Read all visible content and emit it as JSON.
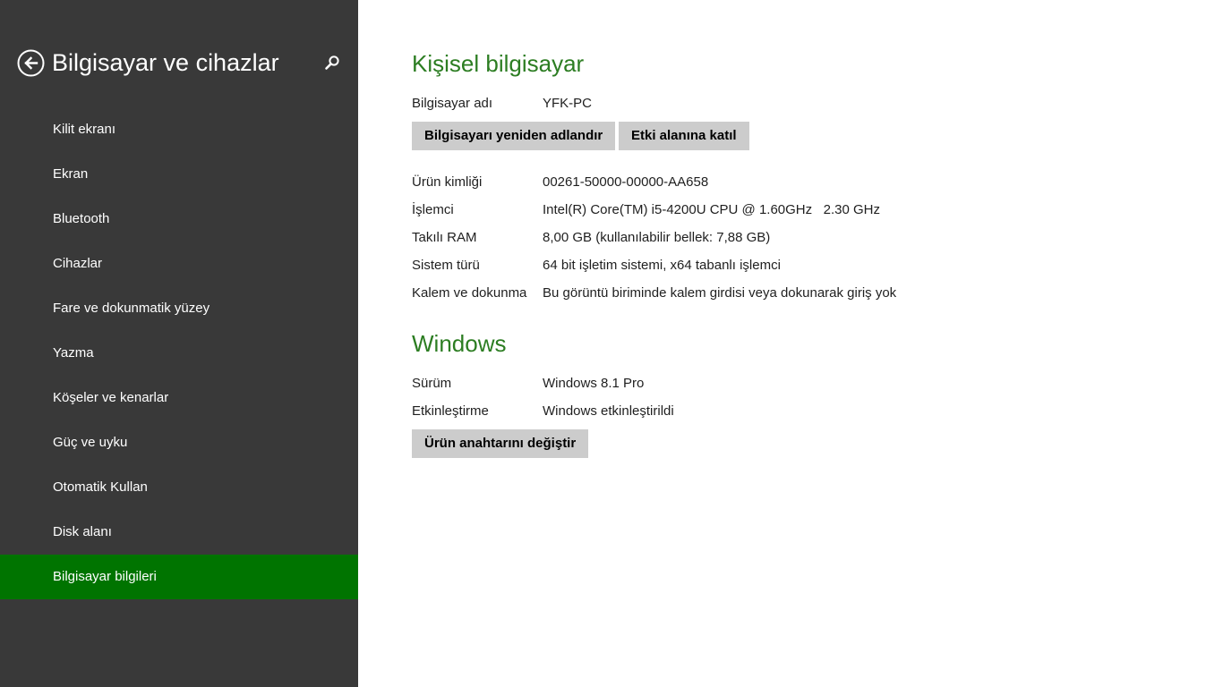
{
  "sidebar": {
    "title": "Bilgisayar ve cihazlar",
    "items": [
      {
        "label": "Kilit ekranı"
      },
      {
        "label": "Ekran"
      },
      {
        "label": "Bluetooth"
      },
      {
        "label": "Cihazlar"
      },
      {
        "label": "Fare ve dokunmatik yüzey"
      },
      {
        "label": "Yazma"
      },
      {
        "label": "Köşeler ve kenarlar"
      },
      {
        "label": "Güç ve uyku"
      },
      {
        "label": "Otomatik Kullan"
      },
      {
        "label": "Disk alanı"
      },
      {
        "label": "Bilgisayar bilgileri"
      }
    ],
    "active_index": 10,
    "background_color": "#393939",
    "active_color": "#007400"
  },
  "pc": {
    "title": "Kişisel bilgisayar",
    "name_label": "Bilgisayar adı",
    "name_value": "YFK-PC",
    "rename_button": "Bilgisayarı yeniden adlandır",
    "join_domain_button": "Etki alanına katıl",
    "specs": [
      {
        "label": "Ürün kimliği",
        "value": "00261-50000-00000-AA658"
      },
      {
        "label": "İşlemci",
        "value": "Intel(R) Core(TM) i5-4200U CPU @ 1.60GHz   2.30 GHz"
      },
      {
        "label": "Takılı RAM",
        "value": "8,00 GB (kullanılabilir bellek: 7,88 GB)"
      },
      {
        "label": "Sistem türü",
        "value": "64 bit işletim sistemi, x64 tabanlı işlemci"
      },
      {
        "label": "Kalem ve dokunma",
        "value": "Bu görüntü biriminde kalem girdisi veya dokunarak giriş yok"
      }
    ]
  },
  "windows": {
    "title": "Windows",
    "edition_label": "Sürüm",
    "edition_value": "Windows 8.1 Pro",
    "activation_label": "Etkinleştirme",
    "activation_value": "Windows etkinleştirildi",
    "change_key_button": "Ürün anahtarını değiştir"
  },
  "accent_color": "#2c7d22",
  "icons": {
    "back": "back-arrow-icon",
    "search": "search-icon"
  }
}
